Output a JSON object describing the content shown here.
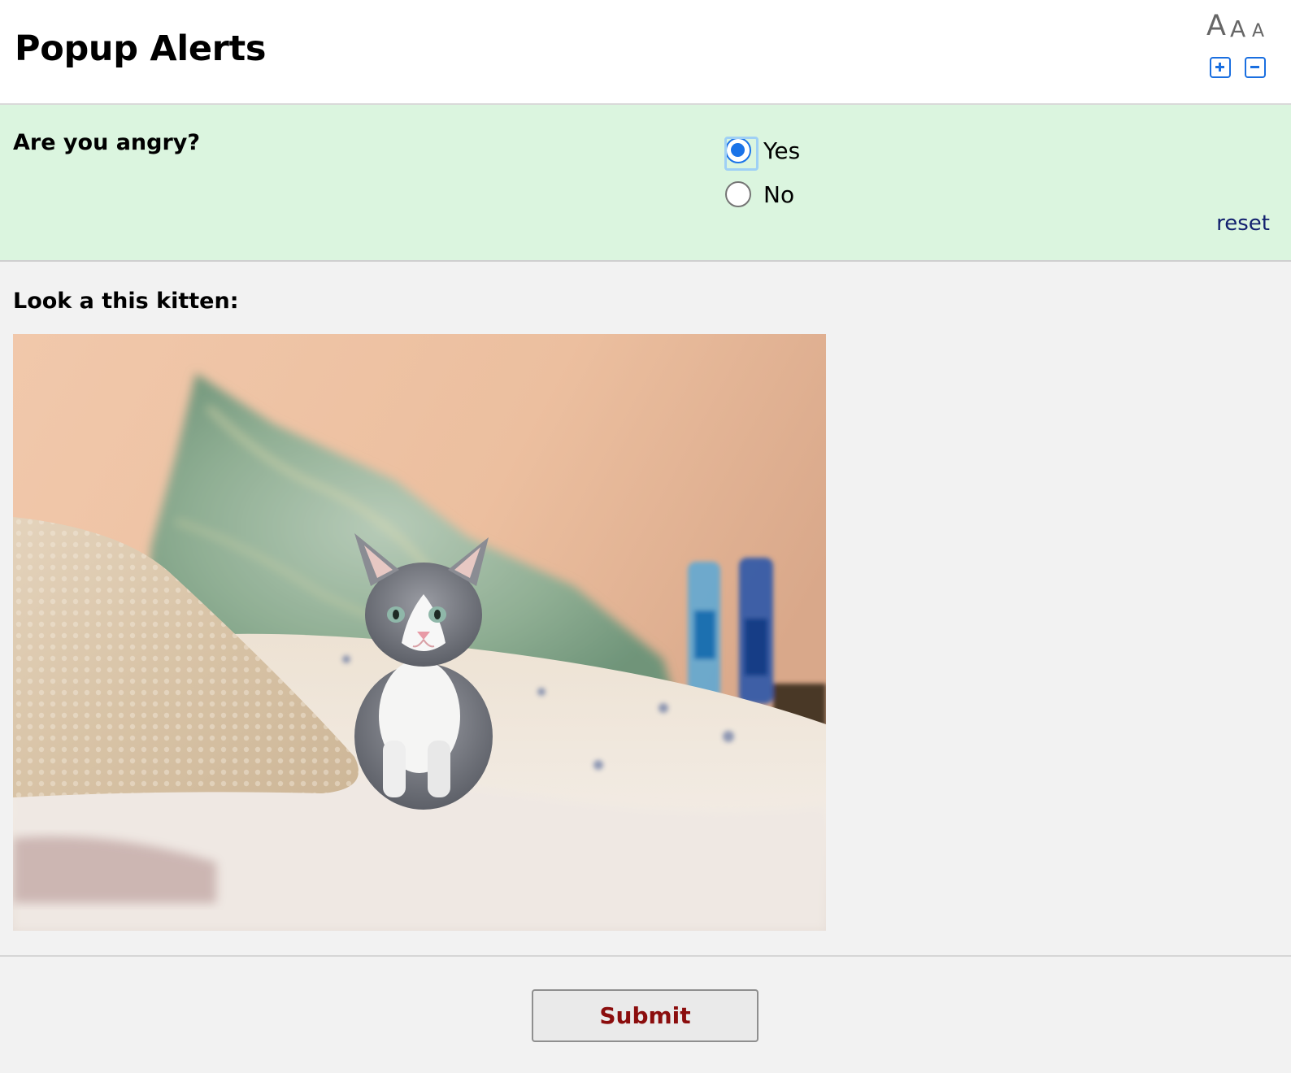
{
  "header": {
    "title": "Popup Alerts",
    "font_size_letters": [
      "A",
      "A",
      "A"
    ]
  },
  "question": {
    "label": "Are you angry?",
    "options": [
      {
        "label": "Yes",
        "selected": true
      },
      {
        "label": "No",
        "selected": false
      }
    ],
    "reset_label": "reset"
  },
  "kitten": {
    "label": "Look a this kitten:"
  },
  "submit": {
    "label": "Submit"
  },
  "colors": {
    "question_bg": "#dbf5df",
    "page_bg": "#f2f2f2",
    "accent": "#1a73e8",
    "submit_text": "#8b0d0d",
    "reset_link": "#12206e"
  },
  "icons": [
    "zoom-in-icon",
    "zoom-out-icon",
    "radio-checked",
    "radio-unchecked"
  ]
}
